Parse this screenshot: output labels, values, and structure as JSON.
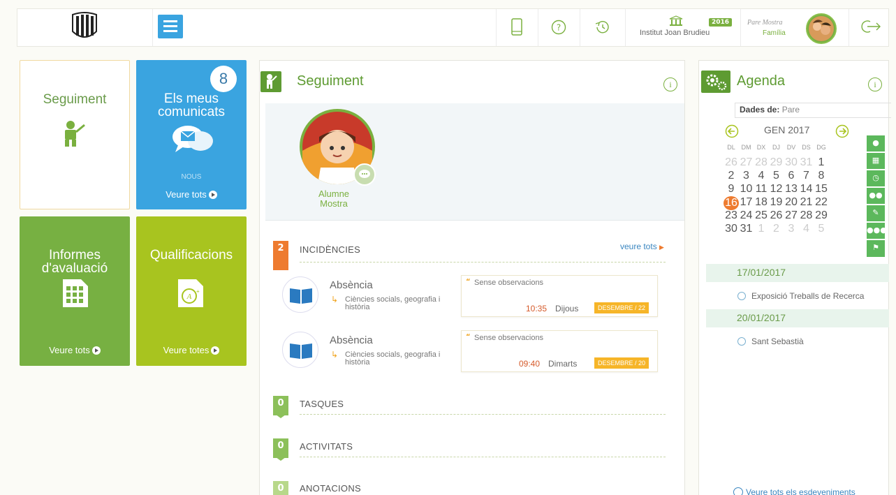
{
  "header": {
    "school": "Institut Joan Brudieu",
    "year": "2016",
    "user_name": "Pare Mostra",
    "user_role": "Família"
  },
  "tiles": {
    "seguiment": {
      "title": "Seguiment"
    },
    "comunicats": {
      "title": "Els meus comunicats",
      "count": "8",
      "status": "NOUS",
      "link": "Veure tots"
    },
    "informes": {
      "title": "Informes d'avaluació",
      "link": "Veure tots"
    },
    "qualificacions": {
      "title": "Qualificacions",
      "link": "Veure totes"
    }
  },
  "seguiment": {
    "title": "Seguiment",
    "student_first": "Alumne",
    "student_last": "Mostra",
    "incidencies": {
      "count": "2",
      "label": "INCIDÈNCIES",
      "see_all": "veure tots",
      "items": [
        {
          "title": "Absència",
          "subject": "Ciències socials, geografia i història",
          "observation": "Sense observacions",
          "time": "10:35",
          "day": "Dijous",
          "date": "DESEMBRE / 22"
        },
        {
          "title": "Absència",
          "subject": "Ciències socials, geografia i història",
          "observation": "Sense observacions",
          "time": "09:40",
          "day": "Dimarts",
          "date": "DESEMBRE / 20"
        }
      ]
    },
    "tasques": {
      "count": "0",
      "label": "TASQUES"
    },
    "activitats": {
      "count": "0",
      "label": "ACTIVITATS"
    },
    "anotacions": {
      "count": "0",
      "label": "ANOTACIONS"
    }
  },
  "agenda": {
    "title": "Agenda",
    "data_label": "Dades de:",
    "data_value": "Pare",
    "month": "GEN 2017",
    "weekdays": [
      "DL",
      "DM",
      "DX",
      "DJ",
      "DV",
      "DS",
      "DG"
    ],
    "weeks": [
      [
        "26",
        "27",
        "28",
        "29",
        "30",
        "31",
        "1"
      ],
      [
        "2",
        "3",
        "4",
        "5",
        "6",
        "7",
        "8"
      ],
      [
        "9",
        "10",
        "11",
        "12",
        "13",
        "14",
        "15"
      ],
      [
        "16",
        "17",
        "18",
        "19",
        "20",
        "21",
        "22"
      ],
      [
        "23",
        "24",
        "25",
        "26",
        "27",
        "28",
        "29"
      ],
      [
        "30",
        "31",
        "1",
        "2",
        "3",
        "4",
        "5"
      ]
    ],
    "today": "16",
    "events": [
      {
        "date": "17/01/2017",
        "title": "Exposició Treballs de Recerca"
      },
      {
        "date": "20/01/2017",
        "title": "Sant Sebastià"
      }
    ],
    "see_all": "Veure tots els esdeveniments"
  },
  "colors": {
    "green": "#5e9b32",
    "blue": "#3aa4e0",
    "lime": "#a8c41f",
    "orange": "#ee7b2f"
  }
}
